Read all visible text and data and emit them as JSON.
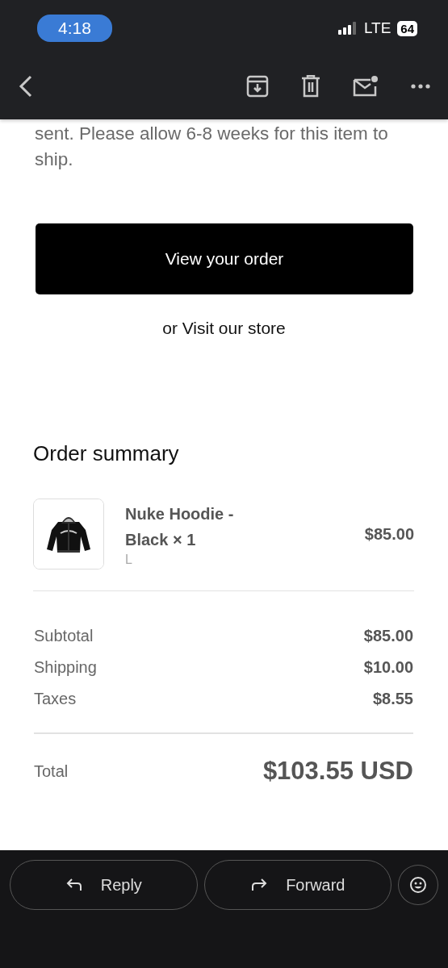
{
  "status_bar": {
    "time": "4:18",
    "network": "LTE",
    "battery": "64"
  },
  "message": {
    "intro": "sent. Please allow 6-8 weeks for this item to ship.",
    "primary_button": "View your order",
    "secondary_link": "or Visit our store"
  },
  "order_summary": {
    "title": "Order summary",
    "items": [
      {
        "kind": "picture",
        "name": "Nuke Hoodie - Black × 1",
        "variant": "L",
        "price": "$85.00"
      }
    ],
    "lines": [
      {
        "label": "Subtotal",
        "value": "$85.00"
      },
      {
        "label": "Shipping",
        "value": "$10.00"
      },
      {
        "label": "Taxes",
        "value": "$8.55"
      }
    ],
    "total": {
      "label": "Total",
      "value": "$103.55 USD"
    }
  },
  "actions": [
    "Reply",
    "Forward"
  ]
}
